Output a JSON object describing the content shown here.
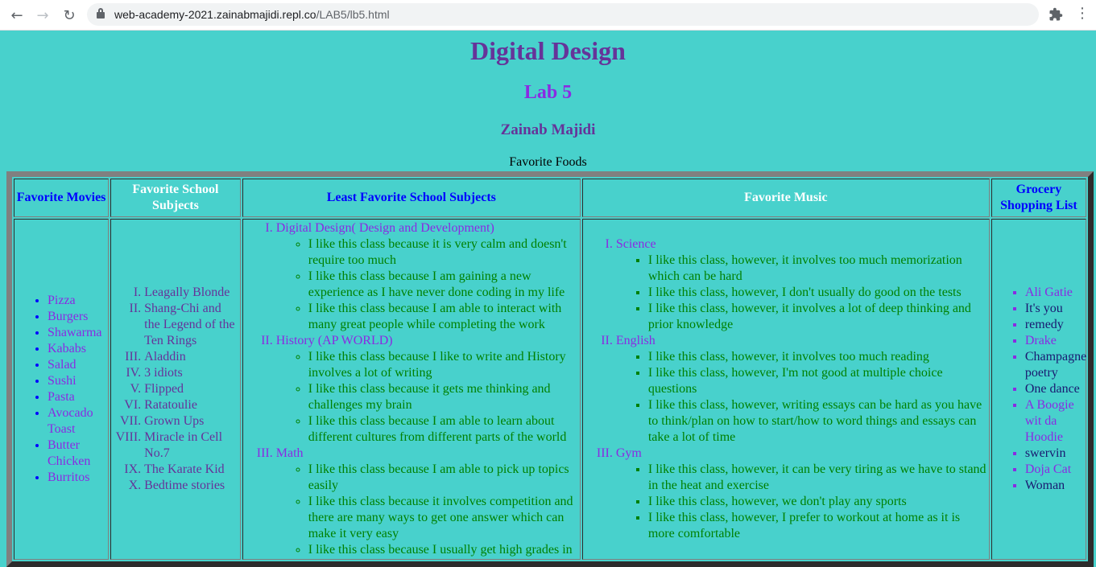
{
  "browser": {
    "url_host": "web-academy-2021.zainabmajidi.repl.co",
    "url_path": "/LAB5/lb5.html"
  },
  "page": {
    "title": "Digital Design",
    "subtitle": "Lab 5",
    "author": "Zainab Majidi",
    "caption": "Favorite Foods"
  },
  "table": {
    "headers": [
      "Favorite Movies",
      "Favorite School Subjects",
      "Least Favorite School Subjects",
      "Favorite Music",
      "Grocery Shopping List"
    ],
    "foods": [
      "Pizza",
      "Burgers",
      "Shawarma",
      "Kababs",
      "Salad",
      "Sushi",
      "Pasta",
      "Avocado Toast",
      "Butter Chicken",
      "Burritos"
    ],
    "movies": [
      "Leagally Blonde",
      "Shang-Chi and the Legend of the Ten Rings",
      "Aladdin",
      "3 idiots",
      "Flipped",
      "Ratatoulie",
      "Grown Ups",
      "Miracle in Cell No.7",
      "The Karate Kid",
      "Bedtime stories"
    ],
    "subjects": [
      {
        "name": "Digital Design( Design and Development)",
        "reasons": [
          "I like this class because it is very calm and doesn't require too much",
          "I like this class because I am gaining a new experience as I have never done coding in my life",
          "I like this class because I am able to interact with many great people while completing the work"
        ]
      },
      {
        "name": "History (AP WORLD)",
        "reasons": [
          "I like this class because I like to write and History involves a lot of writing",
          "I like this class because it gets me thinking and challenges my brain",
          "I like this class because I am able to learn about different cultures from different parts of the world"
        ]
      },
      {
        "name": "Math",
        "reasons": [
          "I like this class because I am able to pick up topics easily",
          "I like this class because it involves competition and there are many ways to get one answer which can make it very easy",
          "I like this class because I usually get high grades in"
        ]
      }
    ],
    "least": [
      {
        "name": "Science",
        "reasons": [
          "I like this class, however, it involves too much memorization which can be hard",
          "I like this class, however, I don't usually do good on the tests",
          "I like this class, however, it involves a lot of deep thinking and prior knowledge"
        ]
      },
      {
        "name": "English",
        "reasons": [
          "I like this class, however, it involves too much reading",
          "I like this class, however, I'm not good at multiple choice questions",
          "I like this class, however, writing essays can be hard as you have to think/plan on how to start/how to word things and essays can take a lot of time"
        ]
      },
      {
        "name": "Gym",
        "reasons": [
          "I like this class, however, it can be very tiring as we have to stand in the heat and exercise",
          "I like this class, however, we don't play any sports",
          "I like this class, however, I prefer to workout at home as it is more comfortable"
        ]
      }
    ],
    "music": [
      {
        "text": "Ali Gatie",
        "color": "#8a2be2"
      },
      {
        "text": "It's you",
        "color": "#191970"
      },
      {
        "text": "remedy",
        "color": "#191970"
      },
      {
        "text": "Drake",
        "color": "#8a2be2"
      },
      {
        "text": "Champagne poetry",
        "color": "#191970"
      },
      {
        "text": "One dance",
        "color": "#191970"
      },
      {
        "text": "A Boogie wit da Hoodie",
        "color": "#8a2be2"
      },
      {
        "text": "swervin",
        "color": "#191970"
      },
      {
        "text": "Doja Cat",
        "color": "#8a2be2"
      },
      {
        "text": "Woman",
        "color": "#191970"
      }
    ]
  }
}
